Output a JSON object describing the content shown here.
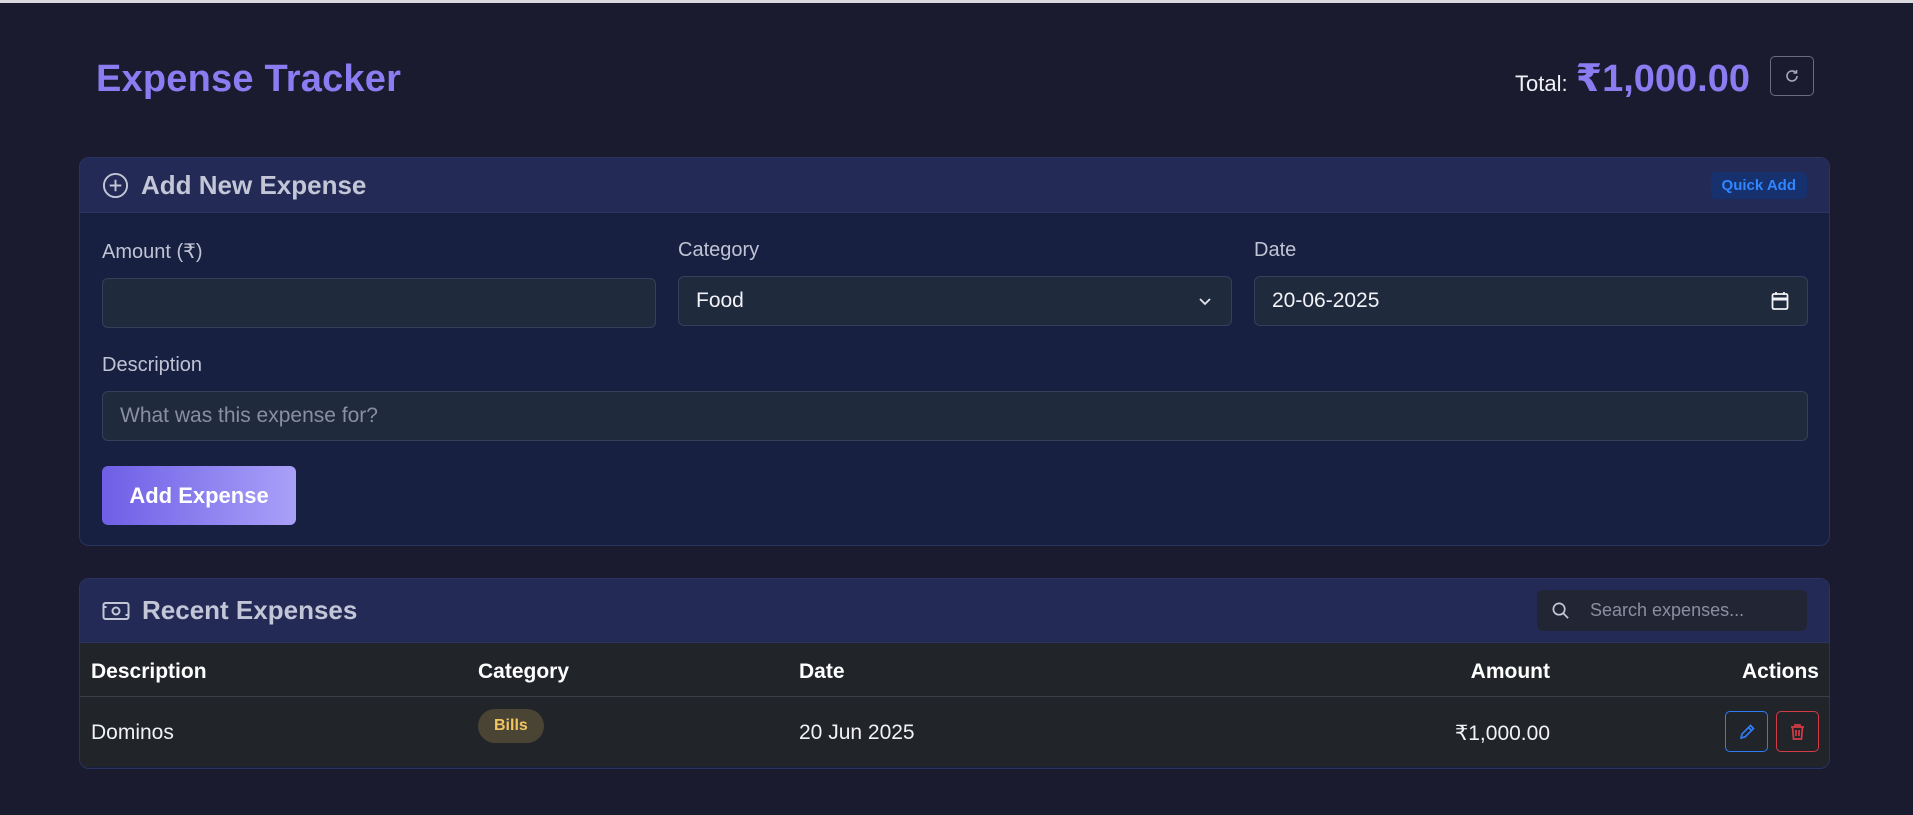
{
  "header": {
    "title": "Expense Tracker",
    "total_label": "Total:",
    "total_value": "₹1,000.00",
    "refresh_icon": "refresh-icon"
  },
  "add_form": {
    "title": "Add New Expense",
    "badge": "Quick Add",
    "amount": {
      "label": "Amount (₹)",
      "value": ""
    },
    "category": {
      "label": "Category",
      "value": "Food"
    },
    "date": {
      "label": "Date",
      "value": "20-06-2025"
    },
    "description": {
      "label": "Description",
      "placeholder": "What was this expense for?"
    },
    "submit_label": "Add Expense"
  },
  "recent": {
    "title": "Recent Expenses",
    "search_placeholder": "Search expenses...",
    "columns": [
      "Description",
      "Category",
      "Date",
      "Amount",
      "Actions"
    ],
    "rows": [
      {
        "description": "Dominos",
        "category": "Bills",
        "date": "20 Jun 2025",
        "amount": "₹1,000.00"
      }
    ]
  },
  "colors": {
    "background": "#1b1b2f",
    "accent": "#8b7cf2",
    "badge_bills_bg": "#4a4434",
    "badge_bills_text": "#f2c462",
    "edit": "#2f7cf6",
    "delete": "#d43b45"
  }
}
